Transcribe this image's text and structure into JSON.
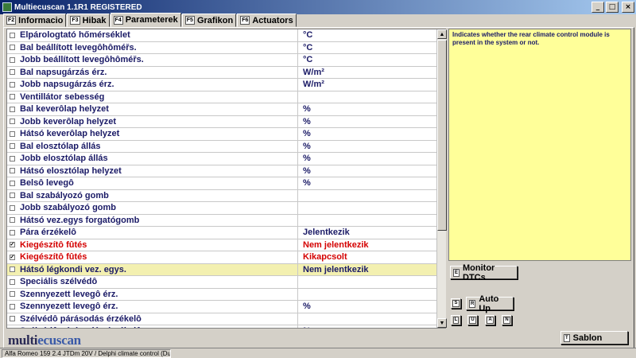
{
  "window": {
    "title": "Multiecuscan 1.1R1 REGISTERED",
    "minimize": "_",
    "maximize": "□",
    "close": "×"
  },
  "tabs": [
    {
      "key": "F2",
      "label": "Informacio"
    },
    {
      "key": "F3",
      "label": "Hibak"
    },
    {
      "key": "F4",
      "label": "Parameterek"
    },
    {
      "key": "F5",
      "label": "Grafikon"
    },
    {
      "key": "F6",
      "label": "Actuators"
    }
  ],
  "active_tab": "Parameterek",
  "parameters": [
    {
      "name": "Elpárologtató hőmérséklet",
      "value": "°C",
      "checked": false,
      "red": false
    },
    {
      "name": "Bal beállított levegôhôméřs.",
      "value": "°C",
      "checked": false,
      "red": false
    },
    {
      "name": "Jobb beállított levegôhôméřs.",
      "value": "°C",
      "checked": false,
      "red": false
    },
    {
      "name": "Bal napsugárzás érz.",
      "value": "W/m²",
      "checked": false,
      "red": false
    },
    {
      "name": "Jobb napsugárzás érz.",
      "value": "W/m²",
      "checked": false,
      "red": false
    },
    {
      "name": "Ventillátor sebesség",
      "value": "",
      "checked": false,
      "red": false
    },
    {
      "name": "Bal keverôlap helyzet",
      "value": "%",
      "checked": false,
      "red": false
    },
    {
      "name": "Jobb keverôlap helyzet",
      "value": "%",
      "checked": false,
      "red": false
    },
    {
      "name": "Hátsó keverôlap helyzet",
      "value": "%",
      "checked": false,
      "red": false
    },
    {
      "name": "Bal elosztólap állás",
      "value": "%",
      "checked": false,
      "red": false
    },
    {
      "name": "Jobb elosztólap állás",
      "value": "%",
      "checked": false,
      "red": false
    },
    {
      "name": "Hátsó elosztólap helyzet",
      "value": "%",
      "checked": false,
      "red": false
    },
    {
      "name": "Belsô levegô",
      "value": "%",
      "checked": false,
      "red": false
    },
    {
      "name": "Bal szabályozó gomb",
      "value": "",
      "checked": false,
      "red": false
    },
    {
      "name": "Jobb szabályozó gomb",
      "value": "",
      "checked": false,
      "red": false
    },
    {
      "name": "Hátsó vez.egys forgatógomb",
      "value": "",
      "checked": false,
      "red": false
    },
    {
      "name": "Pára érzékelô",
      "value": "Jelentkezik",
      "checked": false,
      "red": false
    },
    {
      "name": "Kiegészítô fûtés",
      "value": "Nem jelentkezik",
      "checked": true,
      "red": true
    },
    {
      "name": "Kiegészítô fûtés",
      "value": "Kikapcsolt",
      "checked": true,
      "red": true
    },
    {
      "name": "Hátsó légkondi vez. egys.",
      "value": "Nem jelentkezik",
      "checked": false,
      "red": false,
      "selected": true
    },
    {
      "name": "Speciális szélvédô",
      "value": "",
      "checked": false,
      "red": false
    },
    {
      "name": "Szennyezett levegô érz.",
      "value": "",
      "checked": false,
      "red": false
    },
    {
      "name": "Szennyezett levegô érz.",
      "value": "%",
      "checked": false,
      "red": false
    },
    {
      "name": "Szélvédô párásodás érzékelô",
      "value": "",
      "checked": false,
      "red": false
    },
    {
      "name": "Szélvédô párásodás érzékelô",
      "value": "%",
      "checked": false,
      "red": false
    }
  ],
  "description": "Indicates whether the rear climate control module is present in the system or not.",
  "buttons": {
    "monitor_dtcs": {
      "key": "E",
      "label": "Monitor DTCs"
    },
    "auto_up": {
      "key": "R",
      "label": "Auto Up"
    },
    "s": {
      "key": "S"
    },
    "l": {
      "key": "L"
    },
    "u": {
      "key": "U"
    },
    "a": {
      "key": "A"
    },
    "n": {
      "key": "N"
    },
    "sablon": {
      "key": "T",
      "label": "Sablon"
    }
  },
  "brand": {
    "part1": "multi",
    "part2": "ecuscan"
  },
  "status": "Alfa Romeo 159 2.4 JTDm 20V / Delphi climate control (Dual/three zone)"
}
